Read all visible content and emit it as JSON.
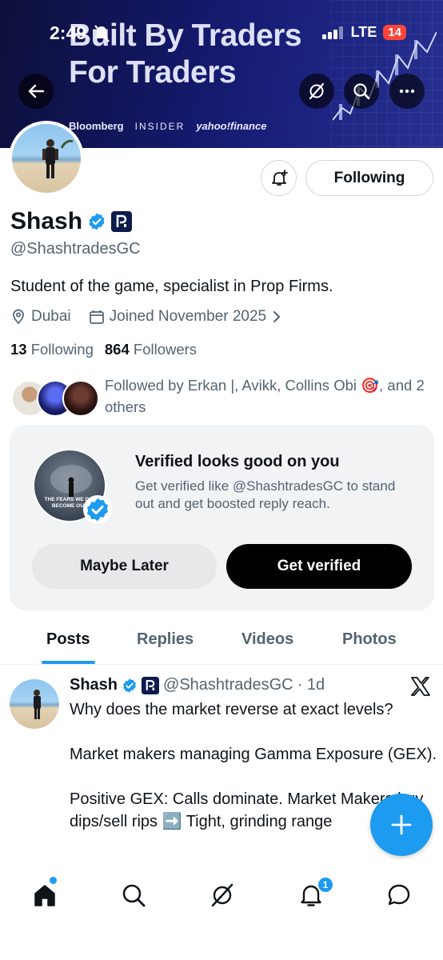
{
  "status_bar": {
    "time": "2:49",
    "network": "LTE",
    "battery": "14"
  },
  "banner": {
    "headline_line1": "Built By Traders",
    "headline_line2": "For Traders",
    "logos": [
      "Bloomberg",
      "INSIDER",
      "yahoo!finance"
    ]
  },
  "header_icons": [
    "back-arrow-icon",
    "grok-icon",
    "search-icon",
    "more-icon"
  ],
  "profile": {
    "name": "Shash",
    "handle": "@ShashtradesGC",
    "bio": "Student of the game, specialist in Prop Firms.",
    "location": "Dubai",
    "joined": "Joined November 2025",
    "following_count": "13",
    "following_label": "Following",
    "followers_count": "864",
    "followers_label": "Followers",
    "follow_button": "Following",
    "followed_by": "Followed by Erkan |, Avikk, Collins Obi 🎯, and 2 others"
  },
  "verify_card": {
    "avatar_text": "THE FEARS WE DON'T BECOME OUR LI",
    "title": "Verified looks good on you",
    "description": "Get verified like @ShashtradesGC to stand out and get boosted reply reach.",
    "maybe_later": "Maybe Later",
    "get_verified": "Get verified"
  },
  "tabs": [
    "Posts",
    "Replies",
    "Videos",
    "Photos"
  ],
  "post": {
    "name": "Shash",
    "handle": "@ShashtradesGC",
    "time": "· 1d",
    "text": "Why does the market reverse at exact levels?\n\nMarket makers managing Gamma Exposure (GEX).\n\nPositive GEX: Calls dominate. Market Makers buy dips/sell rips ➡️ Tight, grinding range"
  },
  "bottom_nav": {
    "items": [
      "home-icon",
      "search-icon",
      "grok-icon",
      "notifications-icon",
      "messages-icon"
    ],
    "notification_count": "1"
  },
  "colors": {
    "accent": "#1d9bf0",
    "text": "#0f1419",
    "muted": "#536471"
  }
}
